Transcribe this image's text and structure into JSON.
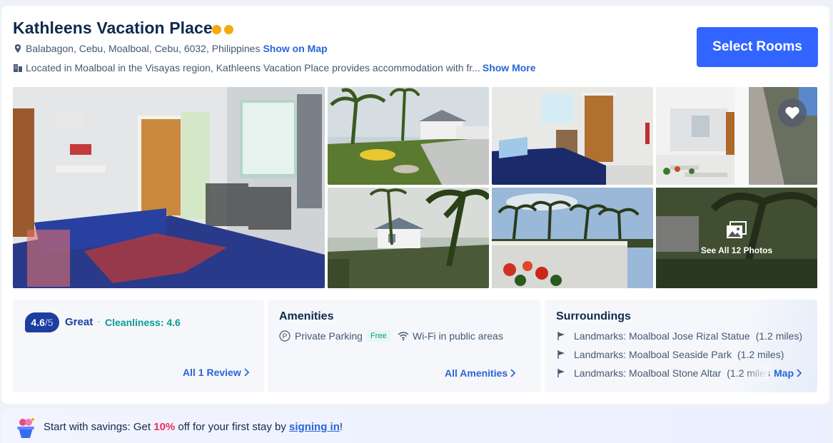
{
  "hotel": {
    "name": "Kathleens Vacation Place",
    "address": "Balabagon, Cebu, Moalboal, Cebu, 6032, Philippines",
    "show_on_map": "Show on Map",
    "description": "Located in Moalboal in the Visayas region, Kathleens Vacation Place provides accommodation with fr...",
    "show_more": "Show More",
    "select_rooms": "Select Rooms",
    "star_color": "#f5a90b",
    "star_count": 2
  },
  "gallery": {
    "see_all": "See All 12 Photos",
    "favorite_icon": "heart-icon"
  },
  "rating": {
    "score": "4.6",
    "out_of": "/5",
    "label": "Great",
    "separator": "·",
    "cleanliness": "Cleanliness: 4.6",
    "reviews_link": "All 1 Review"
  },
  "amenities": {
    "title": "Amenities",
    "items": [
      {
        "label": "Private Parking",
        "badge": "Free",
        "icon": "parking-icon"
      },
      {
        "label": "Wi-Fi in public areas",
        "icon": "wifi-icon"
      }
    ],
    "all_link": "All Amenities"
  },
  "surroundings": {
    "title": "Surroundings",
    "landmarks": [
      {
        "label": "Landmarks: Moalboal Jose Rizal Statue",
        "distance": "(1.2 miles)"
      },
      {
        "label": "Landmarks: Moalboal Seaside Park",
        "distance": "(1.2 miles)"
      },
      {
        "label": "Landmarks: Moalboal Stone Altar",
        "distance": "(1.2 miles"
      }
    ],
    "map_link": "Map"
  },
  "promo": {
    "prefix": "Start with savings: Get ",
    "percent": "10%",
    "middle": " off for your first stay by ",
    "sign_in": "signing in",
    "suffix": "!"
  },
  "colors": {
    "accent": "#3264ff",
    "link": "#2965d9",
    "rating_badge": "#1d3ea1",
    "cleanliness": "#0a9a9a",
    "promo_highlight": "#e8325a"
  }
}
